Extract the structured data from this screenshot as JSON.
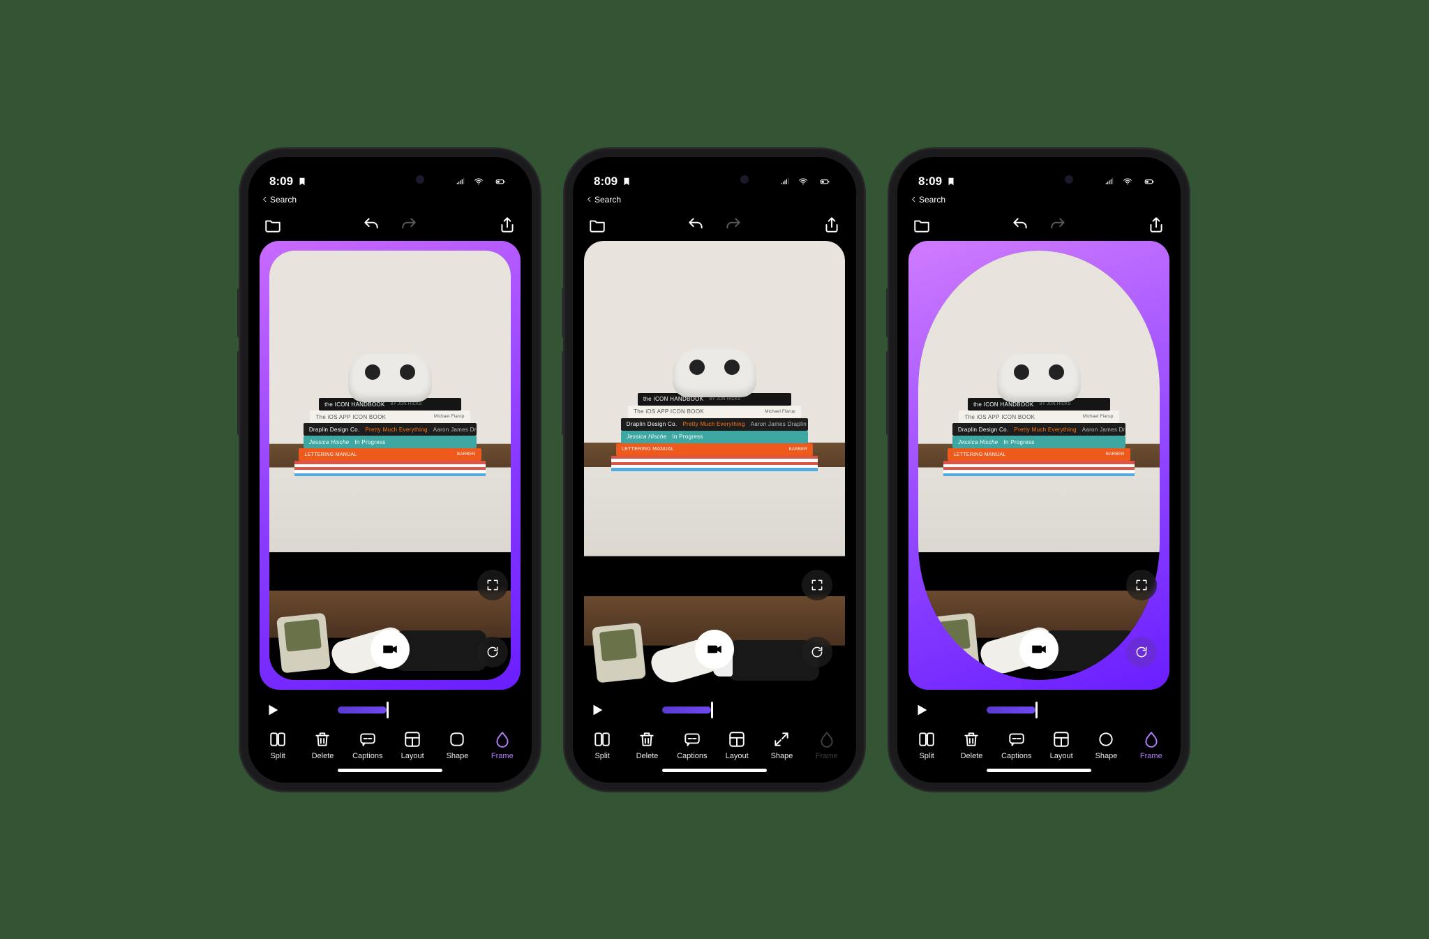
{
  "status": {
    "time": "8:09",
    "breadcrumb": "Search"
  },
  "nav": {
    "folder_icon": "folder-icon",
    "undo_icon": "undo-icon",
    "redo_icon": "redo-icon",
    "share_icon": "share-icon"
  },
  "photo": {
    "books": [
      {
        "title_left": "the ICON HANDBOOK",
        "title_right": "BY JON HICKS"
      },
      {
        "title_left": "The iOS  APP ICON BOOK",
        "title_right": "Michael Flarup"
      },
      {
        "title_left": "Draplin Design Co.",
        "title_mid": "Pretty Much Everything",
        "title_right": "Aaron James Draplin"
      },
      {
        "title_left": "Jessica Hische",
        "title_mid": "In Progress",
        "title_right": ""
      },
      {
        "title_left": "LETTERING MANUAL",
        "title_mid": "",
        "title_right": "BARBER"
      }
    ]
  },
  "toolbar": [
    {
      "key": "split",
      "label": "Split"
    },
    {
      "key": "delete",
      "label": "Delete"
    },
    {
      "key": "captions",
      "label": "Captions"
    },
    {
      "key": "layout",
      "label": "Layout"
    },
    {
      "key": "shape",
      "label": "Shape"
    },
    {
      "key": "frame",
      "label": "Frame"
    }
  ],
  "screens": [
    {
      "frame_style": "rounded",
      "mask_class": "mask-rounded",
      "has_frame_bg": true,
      "shape_icon": "rounded-square",
      "frame_active": true,
      "frame_disabled": false,
      "refresh_active": false
    },
    {
      "frame_style": "full",
      "mask_class": "mask-full",
      "has_frame_bg": false,
      "shape_icon": "expand",
      "frame_active": false,
      "frame_disabled": true,
      "refresh_active": false
    },
    {
      "frame_style": "capsule",
      "mask_class": "mask-capsule",
      "has_frame_bg": true,
      "shape_icon": "circle",
      "frame_active": true,
      "frame_disabled": false,
      "refresh_active": true
    }
  ]
}
